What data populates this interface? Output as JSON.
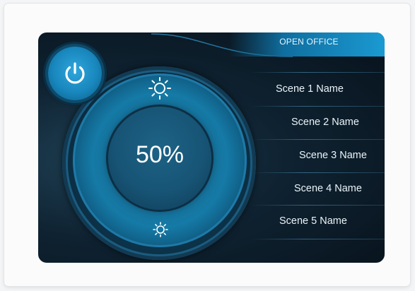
{
  "header": {
    "title": "OPEN OFFICE"
  },
  "dimmer": {
    "level_text": "50%",
    "level_percent": 50
  },
  "controls": {
    "power_icon": "power-icon",
    "brighten_icon": "sun-large-icon",
    "dim_icon": "sun-small-icon"
  },
  "scenes": [
    {
      "label": "Scene 1 Name"
    },
    {
      "label": "Scene 2 Name"
    },
    {
      "label": "Scene 3 Name"
    },
    {
      "label": "Scene 4 Name"
    },
    {
      "label": "Scene 5 Name"
    }
  ],
  "colors": {
    "accent": "#1a9ad2",
    "background": "#07121b",
    "text": "#eaf4fa"
  }
}
